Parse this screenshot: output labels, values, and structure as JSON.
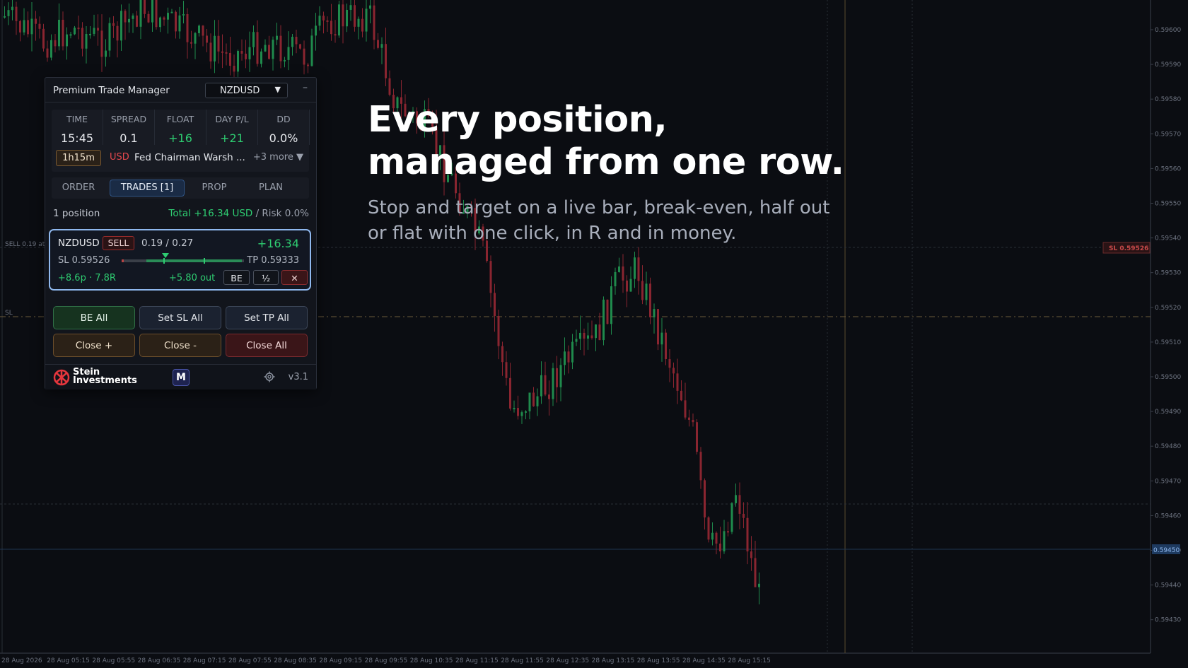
{
  "hero": {
    "title_line1": "Every position,",
    "title_line2": "managed from one row.",
    "subtitle_line1": "Stop and target on a live bar, break-even, half out",
    "subtitle_line2": "or flat with one click, in R and in money."
  },
  "chart": {
    "price_ticks": [
      "0.59600",
      "0.59590",
      "0.59580",
      "0.59570",
      "0.59560",
      "0.59550",
      "0.59540",
      "0.59530",
      "0.59520",
      "0.59510",
      "0.59500",
      "0.59490",
      "0.59480",
      "0.59470",
      "0.59460",
      "0.59450",
      "0.59440",
      "0.59430"
    ],
    "time_ticks": [
      "28 Aug 2026",
      "28 Aug 05:15",
      "28 Aug 05:55",
      "28 Aug 06:35",
      "28 Aug 07:15",
      "28 Aug 07:55",
      "28 Aug 08:35",
      "28 Aug 09:15",
      "28 Aug 09:55",
      "28 Aug 10:35",
      "28 Aug 11:15",
      "28 Aug 11:55",
      "28 Aug 12:35",
      "28 Aug 13:15",
      "28 Aug 13:55",
      "28 Aug 14:35",
      "28 Aug 15:15"
    ],
    "sl_tag": "SL 0.59526",
    "current_price_tag": "0.59450",
    "left_sell_label": "SELL 0.19 at",
    "left_sl_label": "SL",
    "colors": {
      "bull": "#1f8a4c",
      "bear": "#8a2530",
      "sl_line": "#6b5a3a",
      "grid": "#222630"
    }
  },
  "panel": {
    "title": "Premium Trade Manager",
    "symbol": "NZDUSD",
    "symbol_arrow": "▼",
    "minimize": "–",
    "stats": [
      {
        "label": "TIME",
        "value": "15:45"
      },
      {
        "label": "SPREAD",
        "value": "0.1"
      },
      {
        "label": "FLOAT",
        "value": "+16"
      },
      {
        "label": "DAY P/L",
        "value": "+21"
      },
      {
        "label": "DD",
        "value": "0.0%"
      }
    ],
    "news": {
      "time": "1h15m",
      "currency": "USD",
      "title": "Fed Chairman Warsh ...",
      "more": "+3 more ▼"
    },
    "tabs": [
      "ORDER",
      "TRADES [1]",
      "PROP",
      "PLAN"
    ],
    "active_tab": "TRADES [1]",
    "summary": {
      "count": "1 position",
      "total": "Total +16.34 USD",
      "risk": " / Risk 0.0%"
    },
    "trade": {
      "symbol": "NZDUSD",
      "side": "SELL",
      "lots": "0.19 / 0.27",
      "pnl": "+16.34",
      "sl": "SL 0.59526",
      "tp": "TP 0.59333",
      "pips": "+8.6p · 7.8R",
      "out": "+5.80 out",
      "be": "BE",
      "half": "½",
      "close": "✕",
      "progress": 0.41
    },
    "actions": {
      "be_all": "BE All",
      "set_sl_all": "Set SL All",
      "set_tp_all": "Set TP All",
      "close_plus": "Close +",
      "close_minus": "Close -",
      "close_all": "Close All"
    },
    "footer": {
      "logo_line1": "Stein",
      "logo_line2": "Investments",
      "badge": "M",
      "version": "v3.1"
    }
  }
}
